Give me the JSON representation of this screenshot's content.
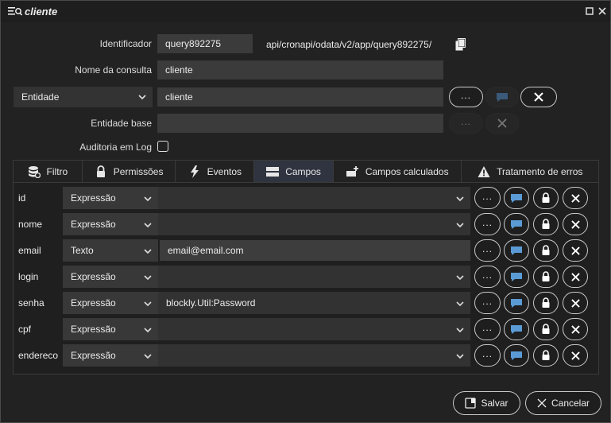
{
  "window": {
    "title": "cliente"
  },
  "form": {
    "identificador_label": "Identificador",
    "identificador_value": "query892275",
    "endpoint": "api/cronapi/odata/v2/app/query892275/",
    "nome_label": "Nome da consulta",
    "nome_value": "cliente",
    "entidade_select": "Entidade",
    "entidade_value": "cliente",
    "entidade_base_label": "Entidade base",
    "entidade_base_value": "",
    "auditoria_label": "Auditoria em Log",
    "ellipsis": "...",
    "accent": "#5b9bd5"
  },
  "tabs": [
    {
      "label": "Filtro",
      "icon": "database-gear-icon"
    },
    {
      "label": "Permissões",
      "icon": "lock-icon"
    },
    {
      "label": "Eventos",
      "icon": "lightning-icon"
    },
    {
      "label": "Campos",
      "icon": "fields-icon"
    },
    {
      "label": "Campos calculados",
      "icon": "calc-field-icon"
    },
    {
      "label": "Tratamento de erros",
      "icon": "warning-icon"
    }
  ],
  "fields": [
    {
      "name": "id",
      "type": "Expressão",
      "value": ""
    },
    {
      "name": "nome",
      "type": "Expressão",
      "value": ""
    },
    {
      "name": "email",
      "type": "Texto",
      "value": "email@email.com"
    },
    {
      "name": "login",
      "type": "Expressão",
      "value": ""
    },
    {
      "name": "senha",
      "type": "Expressão",
      "value": "blockly.Util:Password"
    },
    {
      "name": "cpf",
      "type": "Expressão",
      "value": ""
    },
    {
      "name": "endereco",
      "type": "Expressão",
      "value": ""
    }
  ],
  "footer": {
    "save_label": "Salvar",
    "cancel_label": "Cancelar"
  }
}
